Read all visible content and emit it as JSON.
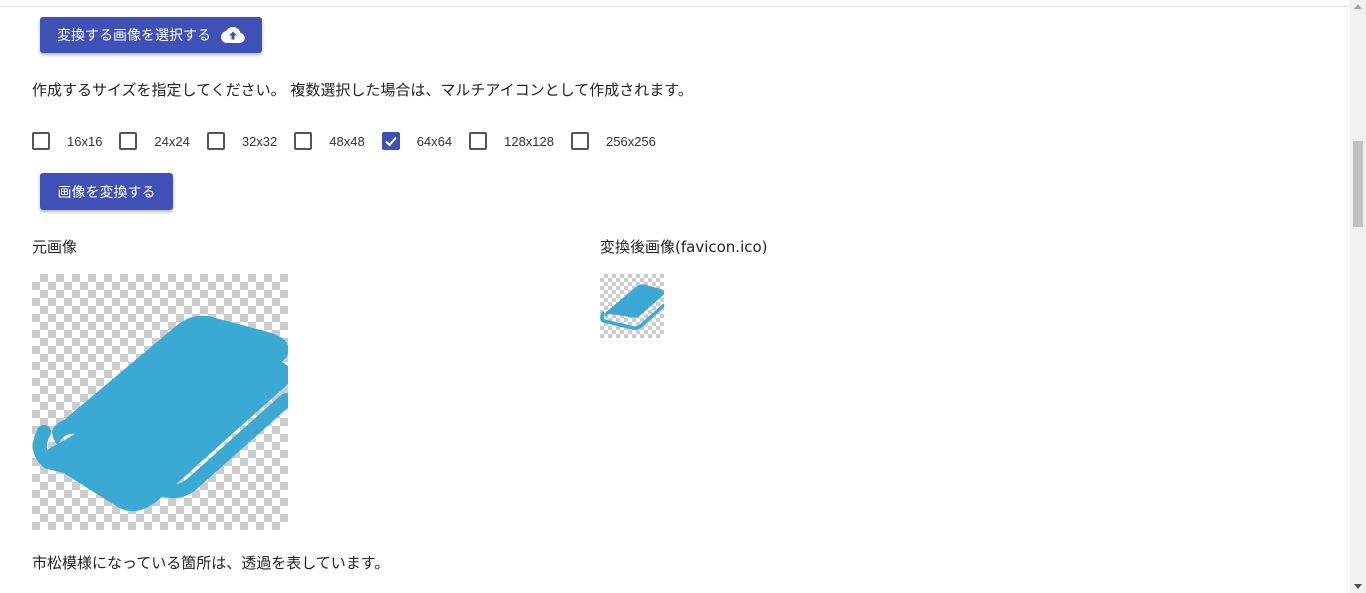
{
  "upload": {
    "label": "変換する画像を選択する",
    "icon": "cloud-upload-icon"
  },
  "instruction": "作成するサイズを指定してください。 複数選択した場合は、マルチアイコンとして作成されます。",
  "sizes": [
    {
      "label": "16x16",
      "checked": false
    },
    {
      "label": "24x24",
      "checked": false
    },
    {
      "label": "32x32",
      "checked": false
    },
    {
      "label": "48x48",
      "checked": false
    },
    {
      "label": "64x64",
      "checked": true
    },
    {
      "label": "128x128",
      "checked": false
    },
    {
      "label": "256x256",
      "checked": false
    }
  ],
  "convert": {
    "label": "画像を変換する"
  },
  "original": {
    "label": "元画像",
    "icon": "book-icon"
  },
  "converted": {
    "label": "変換後画像(favicon.ico)",
    "icon": "book-icon"
  },
  "note": "市松模様になっている箇所は、透過を表しています。",
  "colors": {
    "primary": "#3f51b5",
    "book": "#3aaad4",
    "checker": "#cccccc"
  }
}
